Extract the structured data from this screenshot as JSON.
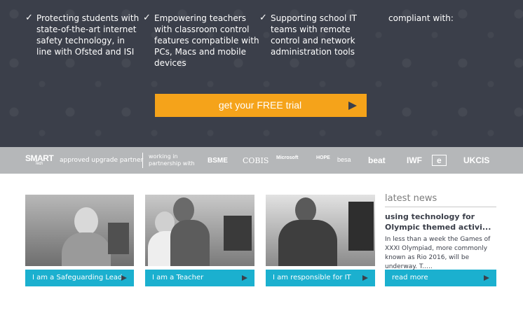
{
  "features": [
    {
      "icon": "check-icon",
      "text": "Protecting students with state-of-the-art internet safety technology, in line with Ofsted and ISI"
    },
    {
      "icon": "check-icon",
      "text": "Empowering teachers with classroom control features compatible with PCs, Macs and mobile devices"
    },
    {
      "icon": "check-icon",
      "text": "Supporting school IT teams with remote control and network administration tools"
    }
  ],
  "compliant_text": "compliant with:",
  "cta": {
    "label": "get your FREE trial",
    "color": "#f5a31a"
  },
  "partners": {
    "smart_logo": "SMART",
    "smart_sub": "Tech",
    "approved": "approved upgrade partner",
    "working_with": "working in partnership with",
    "logos": [
      "BSME",
      "COBIS",
      "Microsoft",
      "HOPE",
      "besa",
      "beat",
      "IWF",
      "e",
      "UKCIS"
    ]
  },
  "cards": [
    {
      "label": "I am a Safeguarding Lead"
    },
    {
      "label": "I am a Teacher"
    },
    {
      "label": "I am responsible for IT"
    }
  ],
  "news": {
    "heading": "latest news",
    "title": "using technology for Olympic themed activi...",
    "body": "In less than a week the Games of XXXI Olympiad, more commonly known as Rio 2016, will be underway. T.....",
    "read_more": "read more"
  },
  "colors": {
    "hero_bg": "#3b3f4a",
    "band_bg": "#b5b7b9",
    "accent": "#1bb0cf"
  }
}
